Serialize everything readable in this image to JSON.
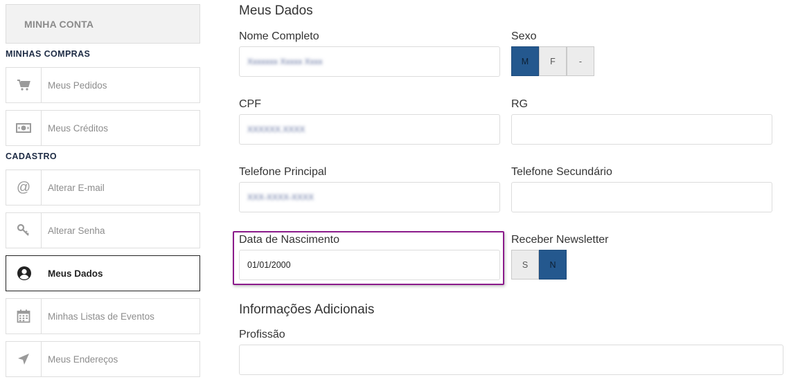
{
  "sidebar": {
    "account_button": "MINHA CONTA",
    "sections": [
      {
        "title": "MINHAS COMPRAS",
        "items": [
          {
            "label": "Meus Pedidos",
            "icon": "cart-icon"
          },
          {
            "label": "Meus Créditos",
            "icon": "money-icon"
          }
        ]
      },
      {
        "title": "CADASTRO",
        "items": [
          {
            "label": "Alterar E-mail",
            "icon": "at-icon"
          },
          {
            "label": "Alterar Senha",
            "icon": "key-icon"
          },
          {
            "label": "Meus Dados",
            "icon": "user-icon",
            "active": true
          },
          {
            "label": "Minhas Listas de Eventos",
            "icon": "calendar-icon"
          },
          {
            "label": "Meus Endereços",
            "icon": "location-arrow-icon"
          }
        ]
      }
    ]
  },
  "main": {
    "title": "Meus Dados",
    "fields": {
      "nome_completo": {
        "label": "Nome Completo",
        "value": "Xxxxxxx Xxxxx Xxxx"
      },
      "sexo": {
        "label": "Sexo",
        "options": [
          "M",
          "F",
          "-"
        ],
        "selected": "M"
      },
      "cpf": {
        "label": "CPF",
        "value": "XXXXXX.XXXX"
      },
      "rg": {
        "label": "RG",
        "value": ""
      },
      "telefone_principal": {
        "label": "Telefone Principal",
        "value": "XXX-XXXX-XXXX"
      },
      "telefone_secundario": {
        "label": "Telefone Secundário",
        "value": ""
      },
      "data_nascimento": {
        "label": "Data de Nascimento",
        "value": "01/01/2000"
      },
      "newsletter": {
        "label": "Receber Newsletter",
        "options": [
          "S",
          "N"
        ],
        "selected": "N"
      }
    },
    "additional_title": "Informações Adicionais",
    "profissao": {
      "label": "Profissão",
      "value": ""
    }
  },
  "colors": {
    "selected_segment": "#24588e",
    "highlight_border": "#8b1a8b",
    "section_title": "#1d2b44"
  }
}
